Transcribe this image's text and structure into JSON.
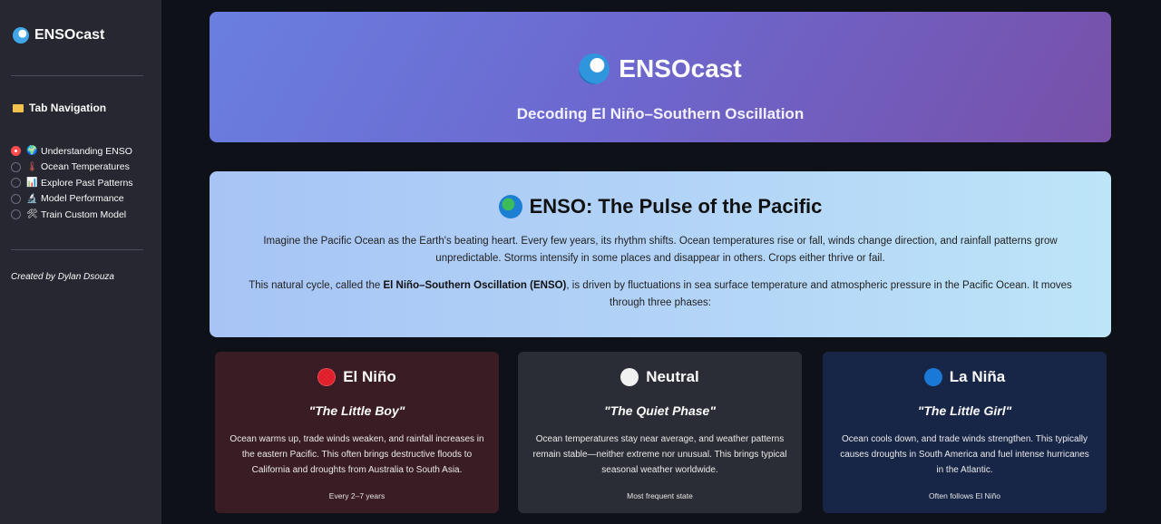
{
  "sidebar": {
    "brand": "ENSOcast",
    "brand_icon": "wave-icon",
    "nav_title": "Tab Navigation",
    "nav_icon": "folder-icon",
    "items": [
      {
        "label": "Understanding ENSO",
        "icon": "globe-icon",
        "selected": true
      },
      {
        "label": "Ocean Temperatures",
        "icon": "thermometer-icon",
        "selected": false
      },
      {
        "label": "Explore Past Patterns",
        "icon": "bar-chart-icon",
        "selected": false
      },
      {
        "label": "Model Performance",
        "icon": "microscope-icon",
        "selected": false
      },
      {
        "label": "Train Custom Model",
        "icon": "tools-icon",
        "selected": false
      }
    ],
    "credit": "Created by Dylan Dsouza"
  },
  "hero": {
    "title": "ENSOcast",
    "subtitle": "Decoding El Niño–Southern Oscillation"
  },
  "intro": {
    "title": "ENSO: The Pulse of the Pacific",
    "paragraph1": "Imagine the Pacific Ocean as the Earth's beating heart. Every few years, its rhythm shifts. Ocean temperatures rise or fall, winds change direction, and rainfall patterns grow unpredictable. Storms intensify in some places and disappear in others. Crops either thrive or fail.",
    "paragraph2_pre": "This natural cycle, called the ",
    "paragraph2_bold": "El Niño–Southern Oscillation (ENSO)",
    "paragraph2_post": ", is driven by fluctuations in sea surface temperature and atmospheric pressure in the Pacific Ocean. It moves through three phases:"
  },
  "phases": [
    {
      "name": "El Niño",
      "nickname": "\"The Little Boy\"",
      "description": "Ocean warms up, trade winds weaken, and rainfall increases in the eastern Pacific. This often brings destructive floods to California and droughts from Australia to South Asia.",
      "footer": "Every 2–7 years",
      "color": "#e0202a"
    },
    {
      "name": "Neutral",
      "nickname": "\"The Quiet Phase\"",
      "description": "Ocean temperatures stay near average, and weather patterns remain stable—neither extreme nor unusual. This brings typical seasonal weather worldwide.",
      "footer": "Most frequent state",
      "color": "#f1f1f1"
    },
    {
      "name": "La Niña",
      "nickname": "\"The Little Girl\"",
      "description": "Ocean cools down, and trade winds strengthen. This typically causes droughts in South America and fuel intense hurricanes in the Atlantic.",
      "footer": "Often follows El Niño",
      "color": "#1a78d6"
    }
  ],
  "colors": {
    "accent": "#ff4b4b",
    "sidebar_bg": "#262730",
    "app_bg": "#0e1117"
  }
}
